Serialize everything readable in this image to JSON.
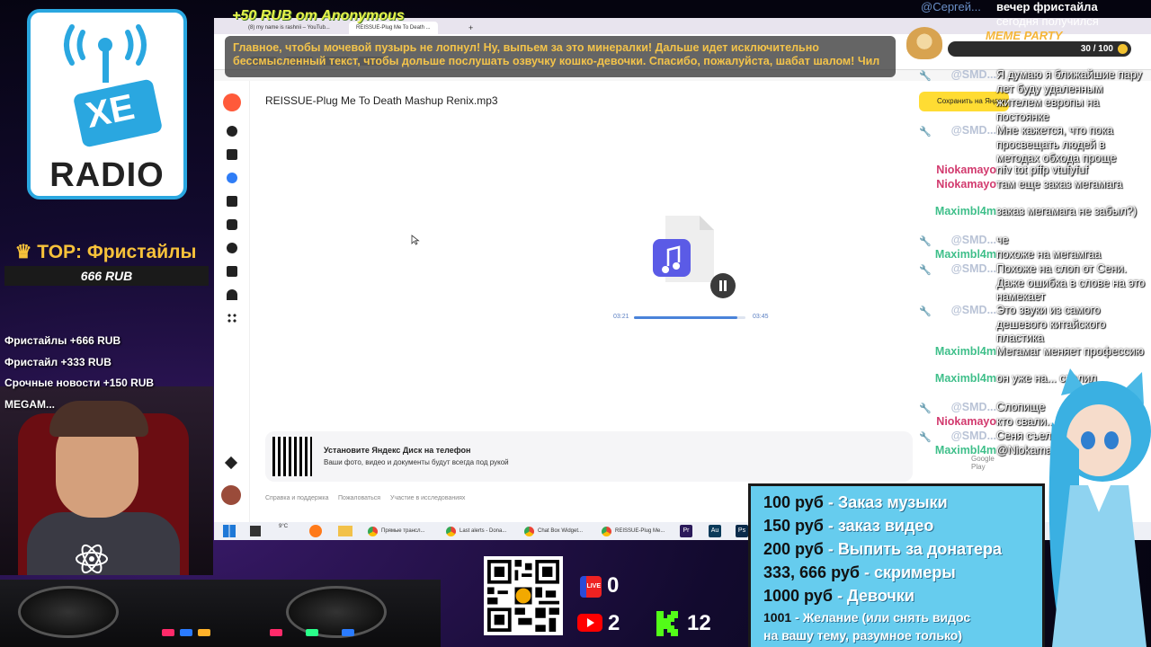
{
  "logo": {
    "brand_top": "XE",
    "brand_bottom": "RADIO"
  },
  "top_donors": {
    "title": "♛ TOP: Фристайлы",
    "amount": "666 RUB",
    "items": [
      "Фристайлы +666 RUB",
      "Фристайл +333 RUB",
      "Срочные новости +150 RUB",
      "MEGAM..."
    ]
  },
  "alert": {
    "header": "+50 RUB  от Anonymous",
    "message": "Главное, чтобы мочевой пузырь не лопнул! Ну, выпьем за это минералки! Дальше идет исключительно бессмысленный текст, чтобы дольше послушать озвучку кошко-девочки. Спасибо, пожалуйста, шабат шалом! Чил"
  },
  "browser": {
    "tabs": [
      "(8) my name is rashnii – YouTub...",
      "REISSUE-Plug Me To Death ..."
    ],
    "new_tab": "+",
    "file_title": "REISSUE-Plug Me To Death Mashup Renix.mp3",
    "save_button": "Сохранить на Яндекс Диск",
    "player": {
      "current_time": "03:21",
      "total_time": "03:45",
      "progress": 0.93
    },
    "promo": {
      "title": "Установите Яндекс Диск на телефон",
      "subtitle": "Ваши фото, видео и документы будут всегда под рукой",
      "store": "Google Play"
    },
    "footer_links": [
      "Справка и поддержка",
      "Пожаловаться",
      "Участие в исследованиях"
    ],
    "taskbar": {
      "items": [
        "Прямые трансл...",
        "Last alerts - Dona...",
        "Chat Box Widget...",
        "REISSUE-Plug Me..."
      ],
      "weather": "9°C",
      "apps": [
        "Pr",
        "Au",
        "Ps"
      ]
    }
  },
  "meme_party": {
    "title": "MEME PARTY",
    "count": "30 / 100"
  },
  "chat_top": {
    "name": "@Сергей...",
    "text1": "вечер фристайла",
    "text2": "сегодня получился"
  },
  "chat": [
    {
      "name": "@SMD...",
      "mod": true,
      "color": "#b9c3d6",
      "text": "Я думаю я ближайшие пару лет буду удаленным жителем европы на постоянке"
    },
    {
      "name": "@SMD...",
      "mod": true,
      "color": "#b9c3d6",
      "text": "Мне кажется, что пока просвещать людей в методах обхода проще"
    },
    {
      "name": "Niokamayo",
      "mod": false,
      "color": "#d23a6e",
      "text": "nfv tot pffp vtufyfuf"
    },
    {
      "name": "Niokamayo",
      "mod": false,
      "color": "#d23a6e",
      "text": "там еще заказ мегамага"
    },
    {
      "name": "Maximbl4m",
      "mod": false,
      "color": "#3fbf8a",
      "text": "заказ мегамага не забыл?)"
    },
    {
      "name": "@SMD...",
      "mod": true,
      "color": "#b9c3d6",
      "text": "че"
    },
    {
      "name": "Maximbl4m",
      "mod": false,
      "color": "#3fbf8a",
      "text": "похоже на мегамгаа"
    },
    {
      "name": "@SMD...",
      "mod": true,
      "color": "#b9c3d6",
      "text": "Похоже на слоп от Сени. Даже ошибка в слове на это намекает"
    },
    {
      "name": "@SMD...",
      "mod": true,
      "color": "#b9c3d6",
      "text": "Это звуки из самого дешевого китайского пластика"
    },
    {
      "name": "Maximbl4m",
      "mod": false,
      "color": "#3fbf8a",
      "text": "Мегамаг меняет профессию"
    },
    {
      "name": "Maximbl4m",
      "mod": false,
      "color": "#3fbf8a",
      "text": "он уже на... свалил"
    },
    {
      "name": "@SMD...",
      "mod": true,
      "color": "#b9c3d6",
      "text": "Слопище"
    },
    {
      "name": "Niokamayo",
      "mod": false,
      "color": "#d23a6e",
      "text": "кто свали..."
    },
    {
      "name": "@SMD...",
      "mod": true,
      "color": "#b9c3d6",
      "text": "Сеня съел"
    },
    {
      "name": "Maximbl4m",
      "mod": false,
      "color": "#3fbf8a",
      "text": "@Niokama... свалил"
    }
  ],
  "price_list": [
    {
      "amount": "100 руб",
      "label": " - Заказ музыки"
    },
    {
      "amount": "150 руб",
      "label": " - заказ видео"
    },
    {
      "amount": "200 руб",
      "label": " - Выпить за донатера"
    },
    {
      "amount": "333, 666 руб",
      "label": " - скримеры"
    },
    {
      "amount": "1000 руб",
      "label": " - Девочки"
    },
    {
      "amount": "1001",
      "label": " - Желание (или снять видос"
    },
    {
      "amount": "",
      "label": "на вашу тему, разумное только)"
    }
  ],
  "counters": {
    "live": "0",
    "youtube": "2",
    "kick": "12",
    "live_label": "LIVE"
  },
  "colors": {
    "accent_blue": "#2aa7e0",
    "yandex_yellow": "#ffdc33",
    "alert_text": "#f3c34a",
    "price_bg": "#66ccee"
  }
}
